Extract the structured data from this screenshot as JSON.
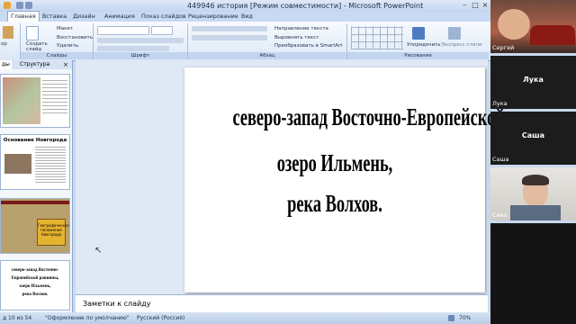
{
  "window": {
    "title": "449946  история [Режим совместимости] - Microsoft PowerPoint"
  },
  "ribbon_tabs": [
    "Главная",
    "Вставка",
    "Дизайн",
    "Анимация",
    "Показ слайдов",
    "Рецензирование",
    "Вид"
  ],
  "ribbon": {
    "groups": [
      "Слайды",
      "Шрифт",
      "Абзац",
      "Рисование"
    ],
    "create_slide": "Создать слайд",
    "layout": "Макет",
    "reset": "Восстановить",
    "delete": "Удалить",
    "text_direction": "Направление текста",
    "align_text": "Выровнять текст",
    "smartart": "Преобразовать в SmartArt",
    "arrange": "Упорядочить",
    "express_styles": "Экспресс-стили",
    "paste_fragment": "ор"
  },
  "left_pane": {
    "tabs": [
      "ды",
      "Структура"
    ],
    "thumb2_title": "Основание Новгорода",
    "thumb3_box": "Географическое положение Новгорода",
    "thumb4_lines": [
      "северо-запад Восточно-Европейской равнины,",
      "озеро Ильмень,",
      "река Волхов."
    ]
  },
  "slide": {
    "lines": [
      "северо-запад Восточно-Европейской равнины,",
      "озеро Ильмень,",
      "река Волхов."
    ]
  },
  "notes": {
    "placeholder": "Заметки к слайду"
  },
  "status_bar": {
    "slide_counter": "д 10 из 54",
    "theme": "\"Оформление по умолчанию\"",
    "language": "Русский (Россия)",
    "zoom": "70%"
  },
  "participants": [
    {
      "name": "Сергей",
      "center_label": ""
    },
    {
      "name": "Лука",
      "center_label": "Лука"
    },
    {
      "name": "Саша",
      "center_label": "Саша"
    },
    {
      "name": "Сева",
      "center_label": ""
    }
  ],
  "colors": {
    "ribbon_bg": "#dce8f7",
    "accent": "#8ea9d2",
    "slide_bg": "#ffffff"
  }
}
